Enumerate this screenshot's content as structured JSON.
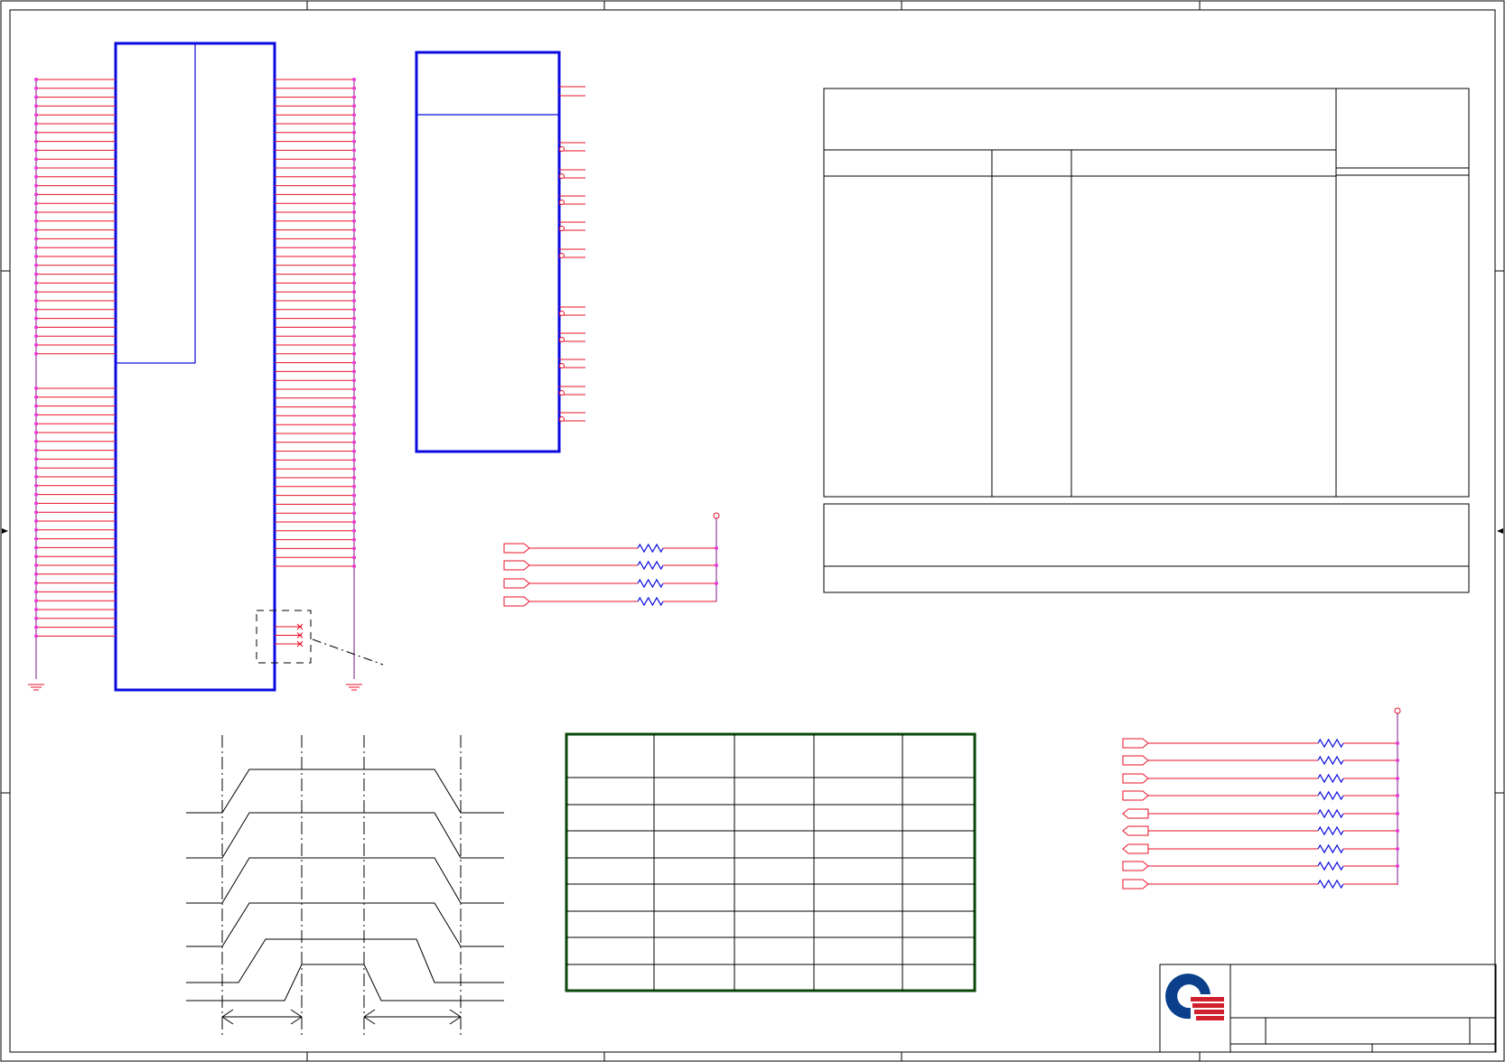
{
  "sheet": {
    "colors": {
      "frame": "#000000",
      "wire": "#e8102a",
      "bus": "#7a1a8a",
      "component": "#0a0ae0",
      "junction": "#e83ad6",
      "table": "#0a4a0a",
      "logo_blue": "#0b3f8c",
      "logo_red": "#d0202e"
    },
    "left_connector": {
      "top_pin_count": 32,
      "bottom_pin_count": 29,
      "right_pin_count": 56
    },
    "buffer_chip": {
      "top_pins": 2,
      "output_pins": 10
    },
    "pullup_group_a": {
      "resistor_count": 4
    },
    "pullup_group_b": {
      "output_ports": 4,
      "input_ports": 3,
      "output_ports_b": 2
    },
    "notes_table": {
      "header_columns": 4,
      "footer_rows": 2
    },
    "timing_diagram": {
      "signal_count": 6,
      "dashed_markers": 4
    },
    "sequence_table": {
      "columns": 5,
      "rows": 9
    },
    "title_block": {
      "logo": "quanta-logo"
    },
    "icons": {
      "ground": "ground-icon",
      "resistor": "resistor-icon",
      "port": "port-icon",
      "logo": "company-logo"
    }
  }
}
